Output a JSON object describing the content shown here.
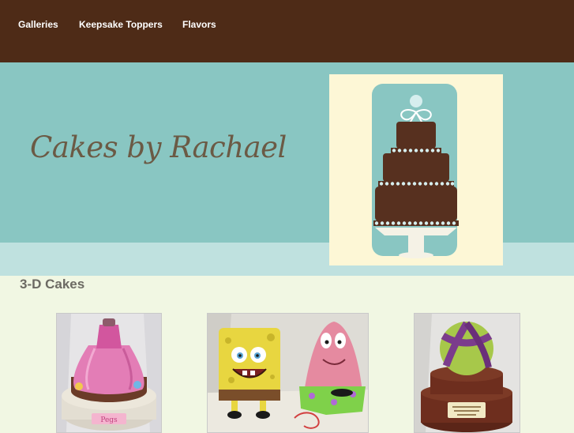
{
  "nav": {
    "items": [
      {
        "label": "Galleries"
      },
      {
        "label": "Keepsake Toppers"
      },
      {
        "label": "Flavors"
      }
    ]
  },
  "header": {
    "title": "Cakes by Rachael"
  },
  "main": {
    "section_title": "3-D Cakes",
    "gallery": [
      {
        "label": "Pegs",
        "icon": "pink-dress-cake"
      },
      {
        "label": "",
        "icon": "spongebob-patrick-cake"
      },
      {
        "label": "",
        "icon": "ball-cake"
      }
    ]
  },
  "colors": {
    "nav_bg": "#4e2b17",
    "banner_bg": "#89c6c2",
    "strip_bg": "#bfe1df",
    "page_bg": "#f1f7e3",
    "cake_brown": "#57301f",
    "logo_bg": "#fdf7d6"
  }
}
